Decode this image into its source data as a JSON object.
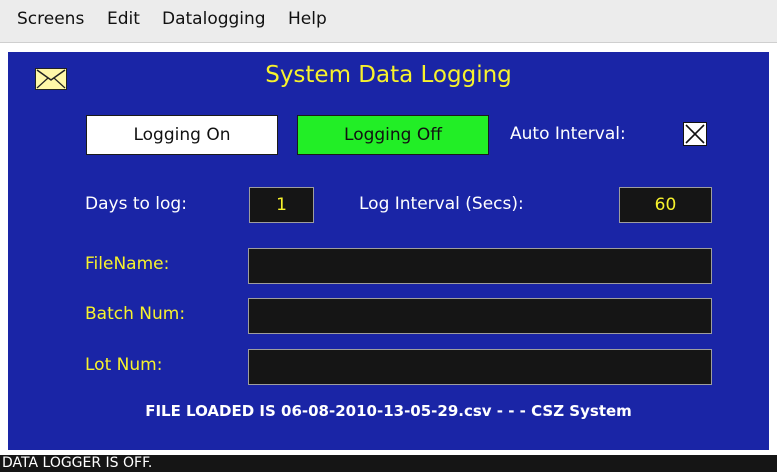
{
  "menu": {
    "items": [
      "Screens",
      "Edit",
      "Datalogging",
      "Help"
    ]
  },
  "header": {
    "title": "System Data Logging",
    "icon": "envelope-icon"
  },
  "controls": {
    "logging_on_label": "Logging On",
    "logging_off_label": "Logging Off",
    "auto_interval_label": "Auto Interval:",
    "auto_interval_checked": true
  },
  "settings": {
    "days_label": "Days to log:",
    "days_value": "1",
    "interval_label": "Log Interval (Secs):",
    "interval_value": "60"
  },
  "fields": {
    "filename_label": "FileName:",
    "filename_value": "",
    "batch_label": "Batch Num:",
    "batch_value": "",
    "lot_label": "Lot Num:",
    "lot_value": ""
  },
  "footer": {
    "message": "FILE LOADED IS 06-08-2010-13-05-29.csv -  -  - CSZ System"
  },
  "status": {
    "text": "DATA LOGGER IS OFF."
  },
  "colors": {
    "panel_bg": "#1a25a6",
    "accent_yellow": "#f7f22c",
    "active_green": "#22ee26"
  }
}
